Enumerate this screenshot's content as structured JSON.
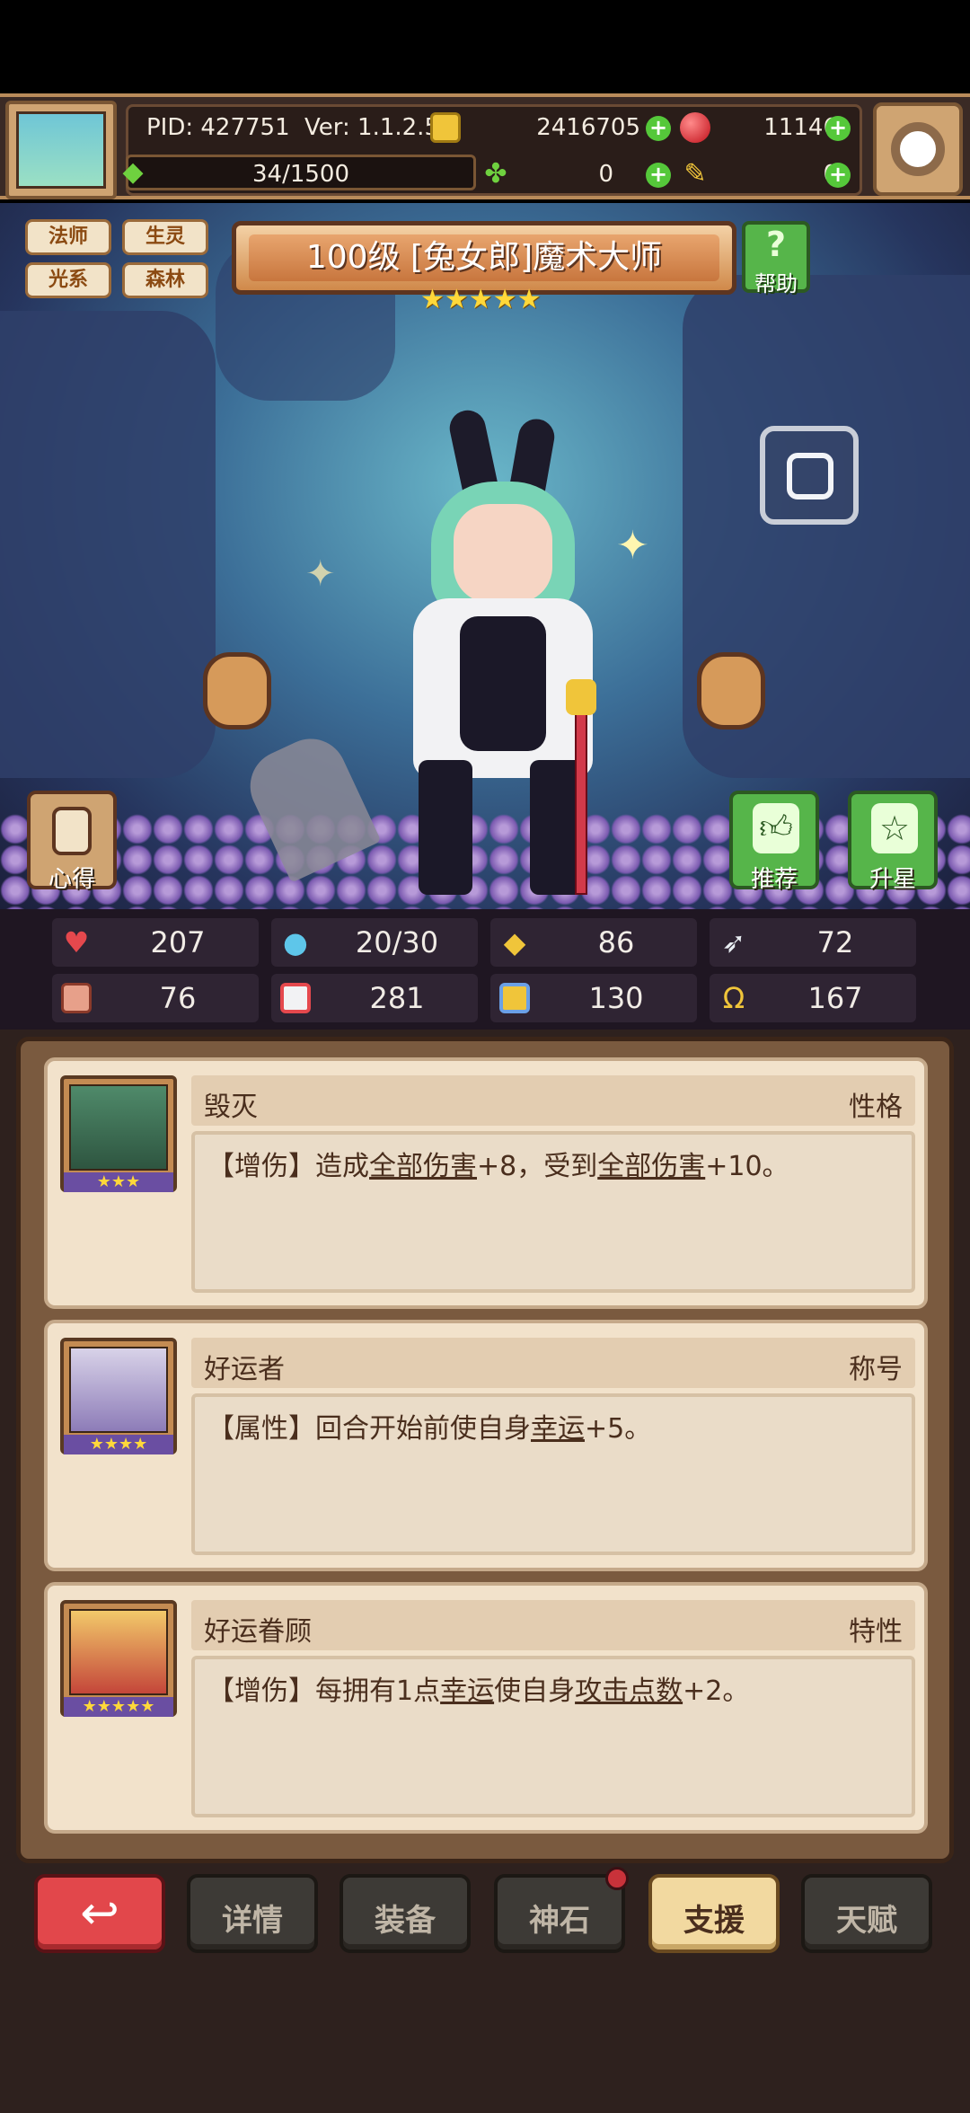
{
  "header": {
    "pid": "PID: 427751",
    "version": "Ver: 1.1.2.5",
    "gold": "2416705",
    "gems": "11146",
    "stamina": "34/1500",
    "clovers": "0",
    "tickets": "0"
  },
  "character": {
    "tags": [
      "法师",
      "生灵",
      "光系",
      "森林"
    ],
    "title": "100级  [兔女郎]魔术大师",
    "stars": "★★★★★",
    "help_label": "帮助",
    "insight_label": "心得",
    "recommend_label": "推荐",
    "upstar_label": "升星"
  },
  "stats": [
    {
      "icon": "heart-icon",
      "value": "207",
      "color": "#e5484d"
    },
    {
      "icon": "water-drop-icon",
      "value": "20/30",
      "color": "#5ec6ea"
    },
    {
      "icon": "shield-icon",
      "value": "86",
      "color": "#f0c53a"
    },
    {
      "icon": "wing-icon",
      "value": "72",
      "color": "#e9eef3"
    },
    {
      "icon": "fist-icon",
      "value": "76",
      "color": "#e7a08a"
    },
    {
      "icon": "book-icon",
      "value": "281",
      "color": "#e5484d"
    },
    {
      "icon": "scroll-icon",
      "value": "130",
      "color": "#6aa0e6"
    },
    {
      "icon": "horseshoe-icon",
      "value": "167",
      "color": "#f0c53a"
    }
  ],
  "cards": [
    {
      "name": "毁灭",
      "type": "性格",
      "stars": "★★★",
      "desc_prefix": "【增伤】造成",
      "desc_link1": "全部伤害",
      "desc_mid": "+8，受到",
      "desc_link2": "全部伤害",
      "desc_suffix": "+10。"
    },
    {
      "name": "好运者",
      "type": "称号",
      "stars": "★★★★",
      "desc_prefix": "【属性】回合开始前使自身",
      "desc_link1": "幸运",
      "desc_suffix": "+5。"
    },
    {
      "name": "好运眷顾",
      "type": "特性",
      "stars": "★★★★★",
      "desc_prefix": "【增伤】每拥有1点",
      "desc_link1": "幸运",
      "desc_mid": "使自身",
      "desc_link2": "攻击点数",
      "desc_suffix": "+2。"
    }
  ],
  "nav": {
    "back_icon": "back-arrow-icon",
    "details": "详情",
    "equipment": "装备",
    "god_stone": "神石",
    "support": "支援",
    "talent": "天赋"
  }
}
